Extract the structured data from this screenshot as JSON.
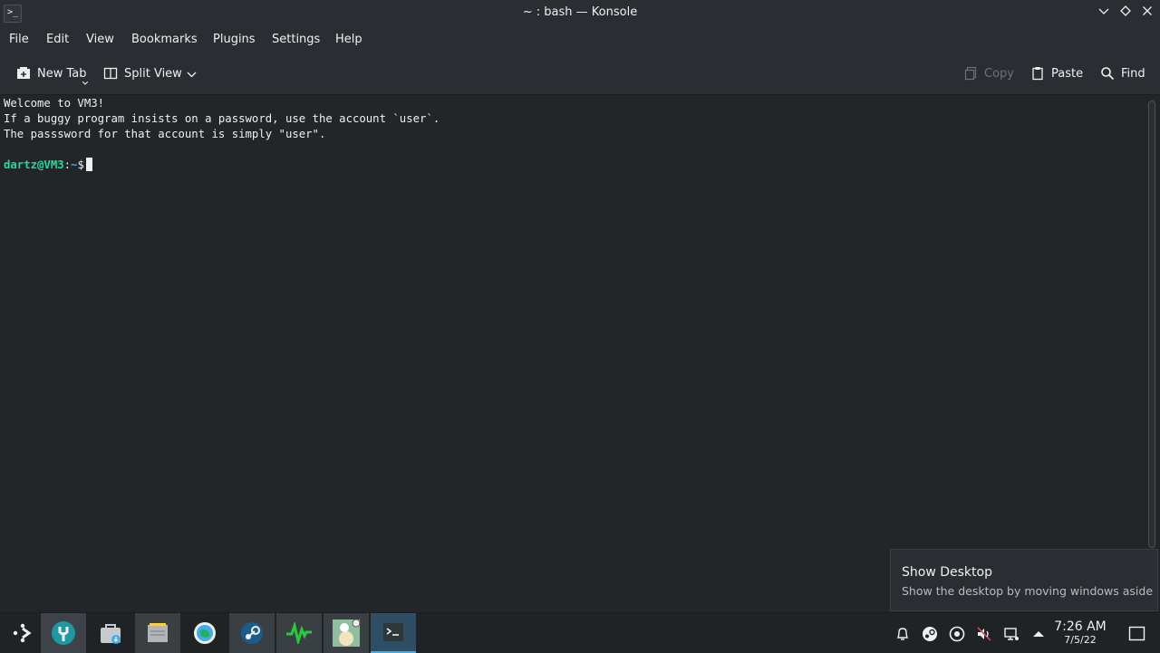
{
  "window": {
    "title": "~ : bash — Konsole",
    "app_icon_glyph": ">_"
  },
  "menubar": {
    "items": [
      "File",
      "Edit",
      "View",
      "Bookmarks",
      "Plugins",
      "Settings",
      "Help"
    ]
  },
  "toolbar": {
    "new_tab_label": "New Tab",
    "split_view_label": "Split View",
    "copy_label": "Copy",
    "paste_label": "Paste",
    "find_label": "Find"
  },
  "terminal": {
    "lines": [
      "Welcome to VM3!",
      "If a buggy program insists on a password, use the account `user`.",
      "The passsword for that account is simply \"user\"."
    ],
    "prompt_user": "dartz@VM3",
    "prompt_sep": ":",
    "prompt_path": "~",
    "prompt_symbol": "$"
  },
  "tooltip": {
    "title": "Show Desktop",
    "subtitle": "Show the desktop by moving windows aside"
  },
  "taskbar": {
    "tasks": [
      "application-launcher",
      "system-settings-wrench",
      "discover-store",
      "dolphin-file-manager",
      "browser-globe",
      "steam",
      "system-monitor",
      "game-app",
      "konsole"
    ],
    "clock_time": "7:26 AM",
    "clock_date": "7/5/22"
  },
  "colors": {
    "background": "#232629",
    "prompt_user": "#1cdc9a",
    "accent": "#3daee9"
  }
}
